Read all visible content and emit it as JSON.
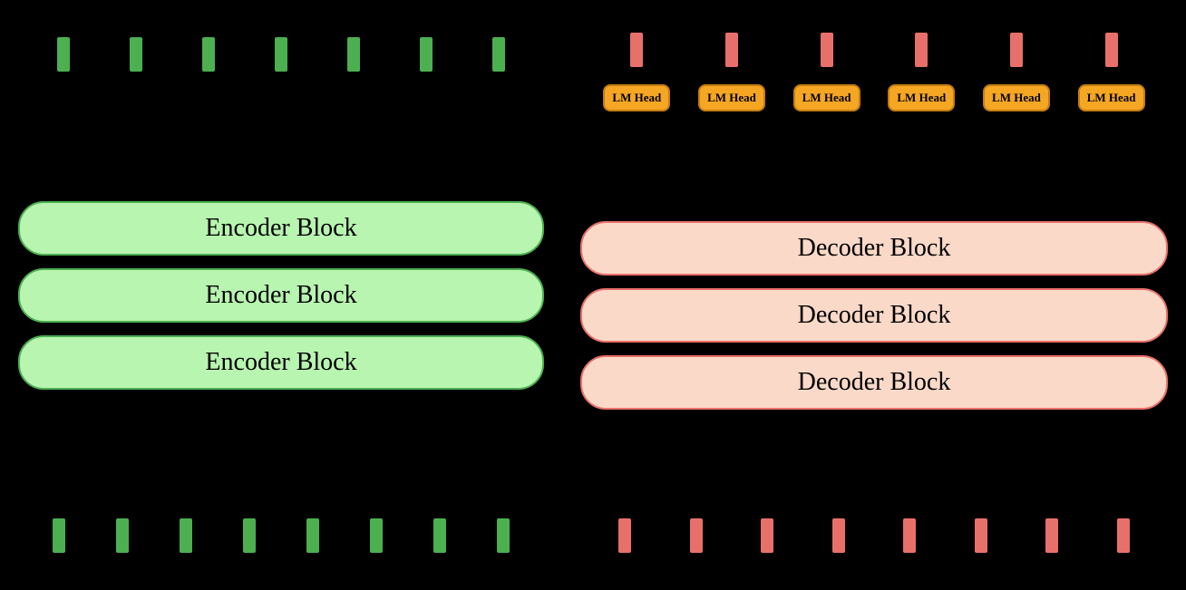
{
  "encoder": {
    "blocks": [
      {
        "label": "Encoder Block"
      },
      {
        "label": "Encoder Block"
      },
      {
        "label": "Encoder Block"
      }
    ],
    "token_count": 7,
    "bottom_token_count": 8
  },
  "decoder": {
    "blocks": [
      {
        "label": "Decoder Block"
      },
      {
        "label": "Decoder Block"
      },
      {
        "label": "Decoder Block"
      }
    ],
    "lm_heads": [
      {
        "label": "LM Head"
      },
      {
        "label": "LM Head"
      },
      {
        "label": "LM Head"
      },
      {
        "label": "LM Head"
      },
      {
        "label": "LM Head"
      },
      {
        "label": "LM Head"
      }
    ],
    "top_token_count": 6,
    "bottom_token_count": 8
  }
}
